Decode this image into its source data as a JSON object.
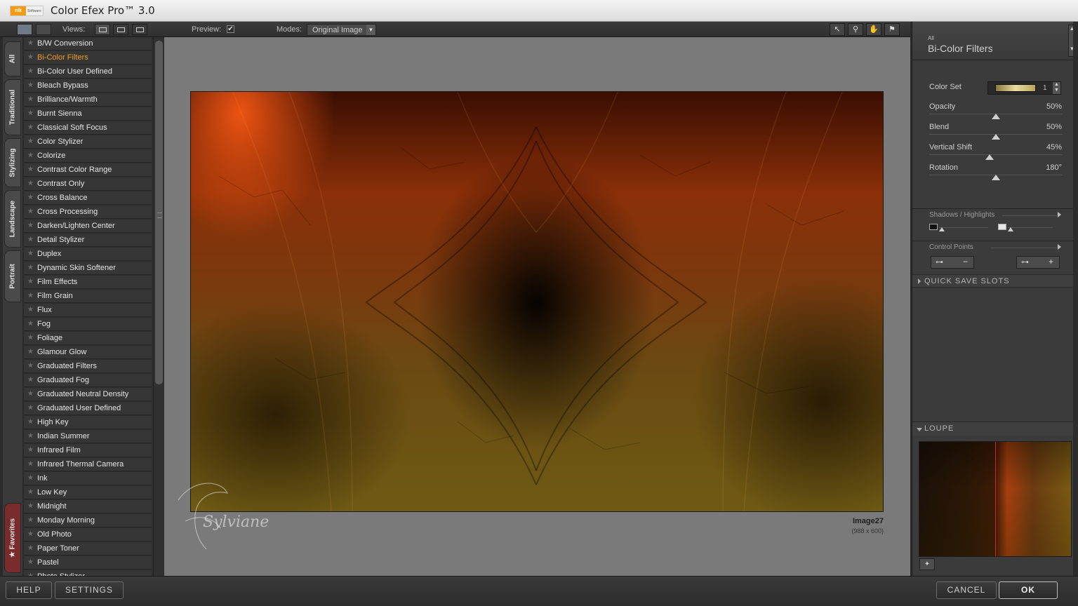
{
  "app": {
    "title": "Color Efex Pro™ 3.0",
    "logo_text": "nik",
    "logo_sub": "Software"
  },
  "toolbar": {
    "views_label": "Views:",
    "preview_label": "Preview:",
    "preview_checked": "✔",
    "modes_label": "Modes:",
    "mode_value": "Original Image",
    "tools": [
      "pointer-icon",
      "zoom-icon",
      "hand-icon",
      "pin-icon"
    ],
    "tool_glyphs": [
      "↖",
      "⚲",
      "✋",
      "⚑"
    ]
  },
  "tabs": [
    "All",
    "Traditional",
    "Stylizing",
    "Landscape",
    "Portrait",
    "★ Favorites"
  ],
  "filters": [
    "B/W Conversion",
    "Bi-Color Filters",
    "Bi-Color User Defined",
    "Bleach Bypass",
    "Brilliance/Warmth",
    "Burnt Sienna",
    "Classical Soft Focus",
    "Color Stylizer",
    "Colorize",
    "Contrast Color Range",
    "Contrast Only",
    "Cross Balance",
    "Cross Processing",
    "Darken/Lighten Center",
    "Detail Stylizer",
    "Duplex",
    "Dynamic Skin Softener",
    "Film Effects",
    "Film Grain",
    "Flux",
    "Fog",
    "Foliage",
    "Glamour Glow",
    "Graduated Filters",
    "Graduated Fog",
    "Graduated Neutral Density",
    "Graduated User Defined",
    "High Key",
    "Indian Summer",
    "Infrared Film",
    "Infrared Thermal Camera",
    "Ink",
    "Low Key",
    "Midnight",
    "Monday Morning",
    "Old Photo",
    "Paper Toner",
    "Pastel",
    "Photo Stylizer"
  ],
  "selected_filter": "Bi-Color Filters",
  "image": {
    "name": "Image27",
    "size": "(988 x 600)",
    "watermark": "Sylviane"
  },
  "panel": {
    "category": "All",
    "filter_title": "Bi-Color Filters",
    "color_set_label": "Color Set",
    "color_set_value": "1",
    "controls": [
      {
        "label": "Opacity",
        "value": "50%",
        "level": 0.5
      },
      {
        "label": "Blend",
        "value": "50%",
        "level": 0.5
      },
      {
        "label": "Vertical Shift",
        "value": "45%",
        "level": 0.45
      },
      {
        "label": "Rotation",
        "value": "180°",
        "level": 0.5
      }
    ],
    "shadows_highlights_label": "Shadows / Highlights",
    "control_points_label": "Control Points",
    "remove_glyph": "−",
    "add_glyph": "+",
    "quick_save_label": "QUICK SAVE SLOTS",
    "loupe_label": "LOUPE"
  },
  "buttons": {
    "help": "HELP",
    "settings": "SETTINGS",
    "cancel": "CANCEL",
    "ok": "OK"
  },
  "colors": {
    "accent": "#f39c12",
    "selected_text": "#f39c12",
    "loupe_line": "#e0202a"
  }
}
